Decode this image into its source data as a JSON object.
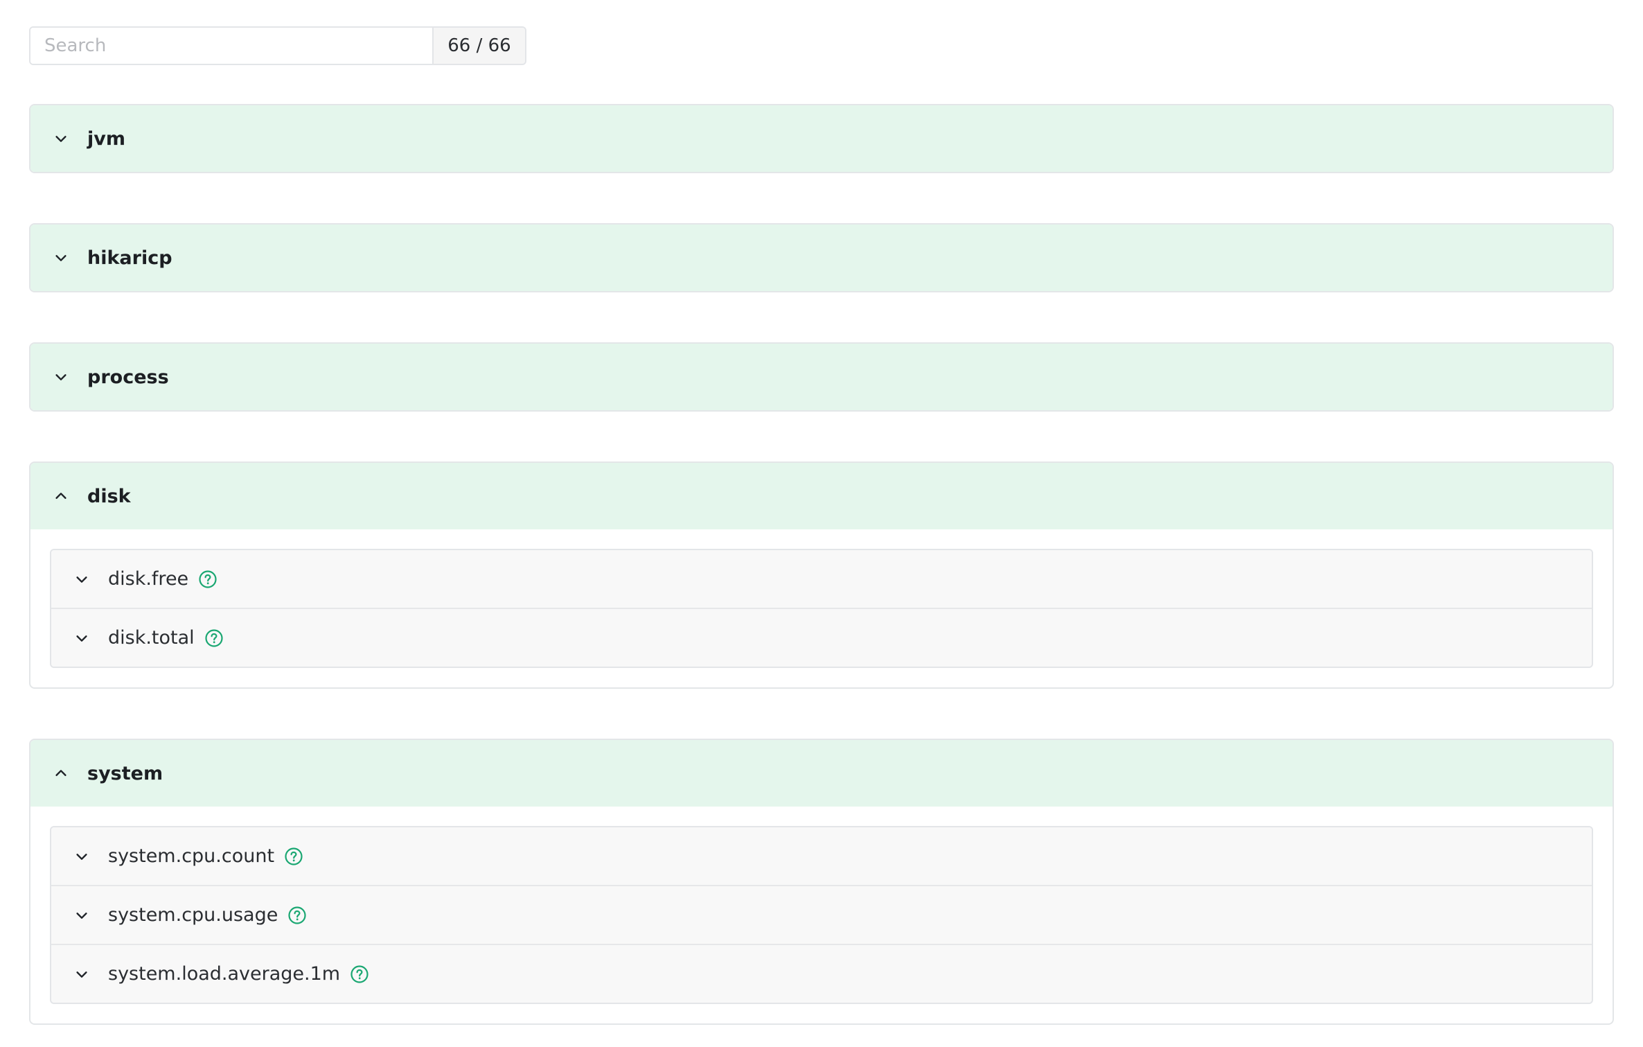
{
  "search": {
    "placeholder": "Search",
    "value": "",
    "count": "66 / 66"
  },
  "groups": [
    {
      "title": "jvm",
      "expanded": false,
      "metrics": []
    },
    {
      "title": "hikaricp",
      "expanded": false,
      "metrics": []
    },
    {
      "title": "process",
      "expanded": false,
      "metrics": []
    },
    {
      "title": "disk",
      "expanded": true,
      "metrics": [
        "disk.free",
        "disk.total"
      ]
    },
    {
      "title": "system",
      "expanded": true,
      "metrics": [
        "system.cpu.count",
        "system.cpu.usage",
        "system.load.average.1m"
      ]
    }
  ],
  "colors": {
    "header_bg": "#e4f6ec",
    "accent": "#1aa772",
    "border": "#e3e5e8",
    "row_bg": "#f8f8f8"
  },
  "icons": {
    "collapsed": "chevron-down-icon",
    "expanded": "chevron-up-icon",
    "help": "help-circle-icon"
  }
}
